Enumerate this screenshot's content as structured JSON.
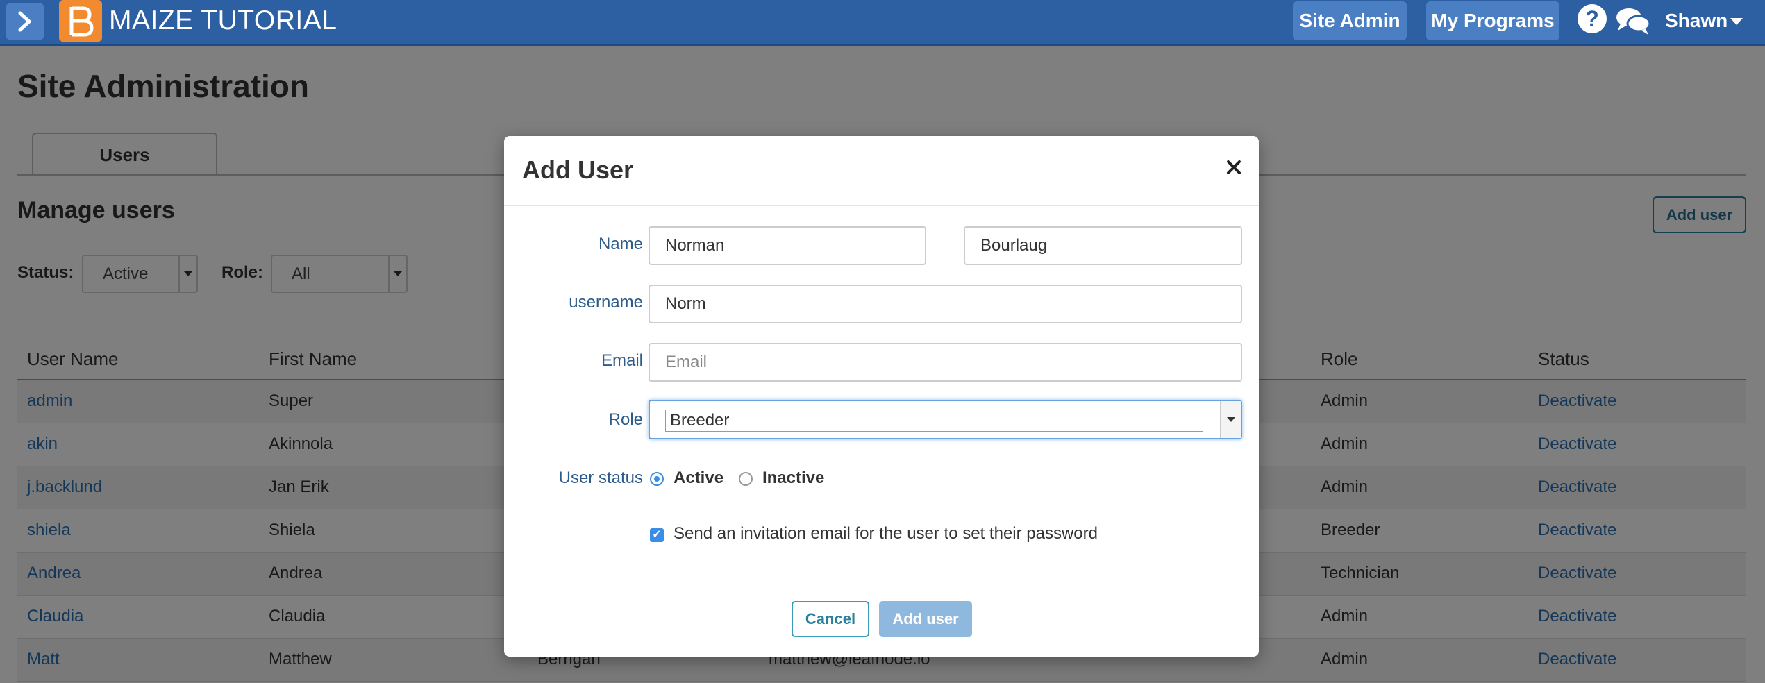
{
  "header": {
    "brand": "MAIZE TUTORIAL",
    "site_admin": "Site Admin",
    "my_programs": "My Programs",
    "user": "Shawn"
  },
  "page": {
    "title": "Site Administration",
    "tab": "Users",
    "section_title": "Manage users",
    "add_user": "Add user",
    "status_label": "Status:",
    "status_value": "Active",
    "role_label": "Role:",
    "role_value": "All"
  },
  "table": {
    "columns": [
      "User Name",
      "First Name",
      "Role",
      "Status"
    ],
    "rows": [
      {
        "username": "admin",
        "first": "Super",
        "last": "",
        "email": "",
        "role": "Admin",
        "status": "Deactivate"
      },
      {
        "username": "akin",
        "first": "Akinnola",
        "last": "",
        "email": "",
        "role": "Admin",
        "status": "Deactivate"
      },
      {
        "username": "j.backlund",
        "first": "Jan Erik",
        "last": "",
        "email": "",
        "role": "Admin",
        "status": "Deactivate"
      },
      {
        "username": "shiela",
        "first": "Shiela",
        "last": "",
        "email": "",
        "role": "Breeder",
        "status": "Deactivate"
      },
      {
        "username": "Andrea",
        "first": "Andrea",
        "last": "",
        "email": "",
        "role": "Technician",
        "status": "Deactivate"
      },
      {
        "username": "Claudia",
        "first": "Claudia",
        "last": "",
        "email": "",
        "role": "Admin",
        "status": "Deactivate"
      },
      {
        "username": "Matt",
        "first": "Matthew",
        "last": "Berrigan",
        "email": "matthew@leafnode.io",
        "role": "Admin",
        "status": "Deactivate"
      }
    ]
  },
  "modal": {
    "title": "Add User",
    "name_label": "Name",
    "first_name": "Norman",
    "last_name": "Bourlaug",
    "username_label": "username",
    "username": "Norm",
    "email_label": "Email",
    "email_placeholder": "Email",
    "role_label": "Role",
    "role_value": "Breeder",
    "status_label": "User status",
    "status_active": "Active",
    "status_inactive": "Inactive",
    "invite_label": "Send an invitation email for the user to set their password",
    "cancel": "Cancel",
    "submit": "Add user"
  },
  "colors": {
    "header": "#2d5fa3",
    "link": "#2a6fb0",
    "accent": "#3a8ee6"
  }
}
